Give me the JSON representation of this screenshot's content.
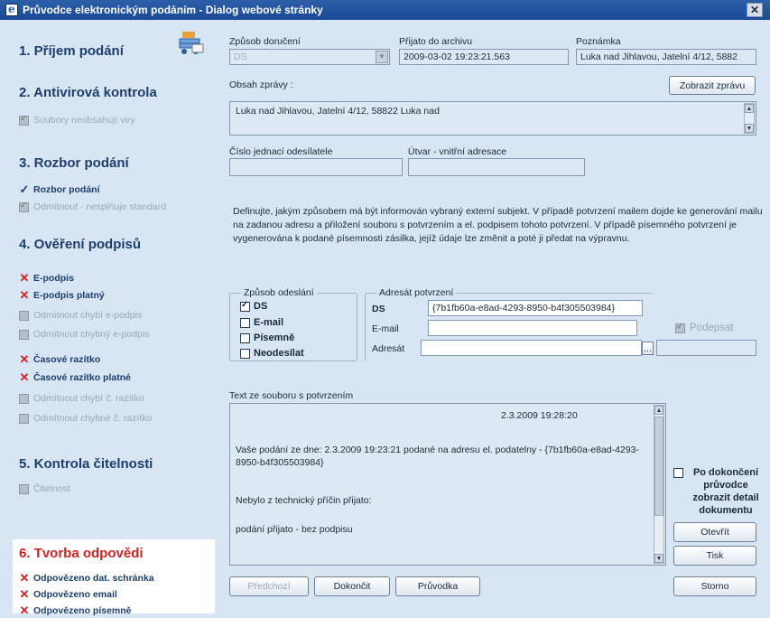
{
  "window": {
    "title": "Průvodce elektronickým podáním - Dialog webové stránky",
    "close_glyph": "✕"
  },
  "left": {
    "step1": "1. Příjem podání",
    "step2": "2. Antivirová kontrola",
    "step2_items": [
      "Soubory neobsahují viry"
    ],
    "step3": "3. Rozbor podání",
    "step3_items": [
      "Rozbor podání",
      "Odmítnout - nesplňuje standard"
    ],
    "step4": "4. Ověření podpisů",
    "step4_items": [
      "E-podpis",
      "E-podpis platný",
      "Odmítnout chybí e-podpis",
      "Odmítnout chybný e-podpis",
      "Časové razítko",
      "Časové razítko platné",
      "Odmítnout chybí č. razítko",
      "Odmítnout chybné č. razítko"
    ],
    "step5": "5. Kontrola čitelnosti",
    "step5_items": [
      "Čitelnost"
    ],
    "step6": "6. Tvorba odpovědi",
    "step6_items": [
      "Odpovězeno dat. schránka",
      "Odpovězeno email",
      "Odpovězeno písemně"
    ]
  },
  "form": {
    "zpusob_doruceni_label": "Způsob doručení",
    "zpusob_doruceni_value": "DS",
    "prijato_label": "Přijato do archivu",
    "prijato_value": "2009-03-02 19:23:21.563",
    "poznamka_label": "Poznámka",
    "poznamka_value": "Luka nad Jihlavou, Jatelní 4/12, 5882",
    "obsah_label": "Obsah zprávy :",
    "zobrazit_button": "Zobrazit zprávu",
    "obsah_value": "Luka nad Jihlavou, Jatelní 4/12, 58822 Luka nad",
    "cislo_label": "Číslo jednací odesílatele",
    "utvar_label": "Útvar - vnitřní adresace",
    "info_text": "Definujte, jakým způsobem má být informován vybraný externí subjekt. V případě potvrzení mailem dojde ke generování mailu na zadanou adresu a přiložení souboru s potvrzením a el. podpisem tohoto potvrzení. V případě písemného potvrzení je vygenerována k podané písemnosti zásilka, jejíž údaje lze změnit a poté ji předat na výpravnu.",
    "zpusob_odeslani_title": "Způsob odeslání",
    "odeslani_options": [
      "DS",
      "E-mail",
      "Písemně",
      "Neodesílat"
    ],
    "adresat_title": "Adresát potvrzení",
    "ds_label": "DS",
    "ds_value": "{7b1fb60a-e8ad-4293-8950-b4f305503984}",
    "email_label": "E-mail",
    "adresat_label": "Adresát",
    "browse_glyph": "...",
    "podepsat_label": "Podepsat",
    "text_title": "Text ze souboru s potvrzením",
    "text_date": "2.3.2009 19:28:20",
    "text_line1": "Vaše podání ze dne: 2.3.2009 19:23:21 podané na adresu el. podatelny - {7b1fb60a-e8ad-4293-8950-b4f305503984}",
    "text_line2": "Nebylo z technický příčin přijato:",
    "text_line3": "podání přijato - bez podpisu",
    "po_dokonceni_label": "Po dokončení průvodce zobrazit detail dokumentu",
    "otevrit_button": "Otevřít",
    "tisk_button": "Tisk",
    "predchozi_button": "Předchozí",
    "dokoncit_button": "Dokončit",
    "pruvodka_button": "Průvodka",
    "storno_button": "Storno"
  }
}
